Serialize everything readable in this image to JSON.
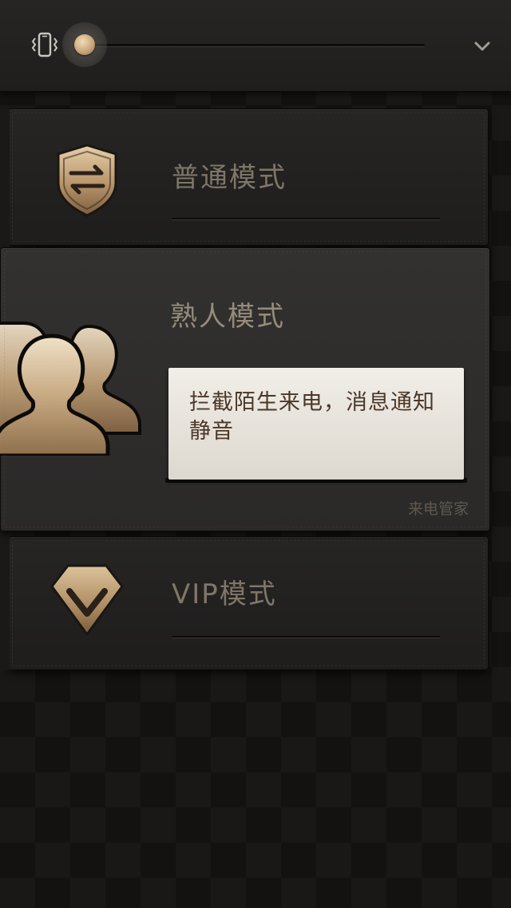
{
  "top_bar": {
    "vibrate_icon": "vibrate-phone-icon",
    "slider_value": 0.0,
    "collapse_icon": "chevron-down-icon"
  },
  "modes": {
    "normal": {
      "label": "普通模式",
      "icon": "shield-swap-icon"
    },
    "acquaintance": {
      "label": "熟人模式",
      "icon": "people-icon",
      "description": "拦截陌生来电，消息通知静音",
      "attribution": "来电管家"
    },
    "vip": {
      "label": "VIP模式",
      "icon": "diamond-v-icon"
    }
  },
  "colors": {
    "accent_gold": "#c9a67b",
    "card_text": "#7f7668",
    "description_bg": "#ebe7e0",
    "description_text": "#4b3727"
  }
}
